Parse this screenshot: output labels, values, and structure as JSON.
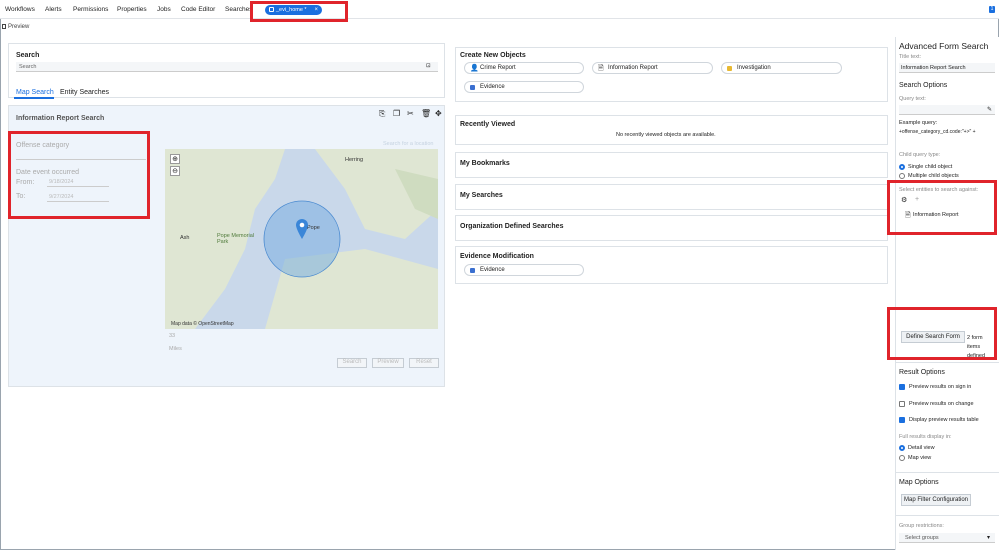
{
  "nav": {
    "items": [
      "Workflows",
      "Alerts",
      "Permissions",
      "Properties",
      "Jobs",
      "Code Editor",
      "Searches"
    ],
    "active_tab": "_evi_home *",
    "tab_close": "×",
    "badge": "1"
  },
  "preview_label": "Preview",
  "left": {
    "search_heading": "Search",
    "search_placeholder": "Search",
    "tabs": [
      "Map Search",
      "Entity Searches"
    ],
    "form_title": "Information Report Search",
    "offense_label": "Offense category",
    "date_label": "Date event occurred",
    "from_label": "From:",
    "to_label": "To:",
    "from_value": "9/18/2024",
    "to_value": "9/27/2024",
    "map_credit": "Map data © OpenStreetMap",
    "map_label_herring": "Herring",
    "map_label_ash": "Ash",
    "map_label_park": "Pope Memorial Park",
    "map_label_town": "Pope",
    "search_btn": "Search",
    "preview_btn": "Preview",
    "reset_btn": "Reset",
    "zoom_value": "33",
    "miles": "Miles",
    "selection_hint": "Search for a location"
  },
  "middle": {
    "create_title": "Create New Objects",
    "create_items": [
      "Crime Report",
      "Information Report",
      "Investigation",
      "Evidence"
    ],
    "recent_title": "Recently Viewed",
    "recent_empty": "No recently viewed objects are available.",
    "bookmarks_title": "My Bookmarks",
    "searches_title": "My Searches",
    "org_title": "Organization Defined Searches",
    "evmod_title": "Evidence Modification",
    "evmod_item": "Evidence"
  },
  "right": {
    "title": "Advanced Form Search",
    "title_text_label": "Title text:",
    "title_text_value": "Information Report Search",
    "search_options": "Search Options",
    "query_text_label": "Query text:",
    "example_label": "Example query:",
    "example_value": "+offense_category_cd.code:\"+>\" +",
    "child_query_label": "Child query type:",
    "single_child": "Single child object",
    "multiple_child": "Multiple child objects",
    "select_entities": "Select entities to search against:",
    "entity_item": "Information Report",
    "define_btn": "Define Search Form",
    "form_count": "2 form items defined",
    "result_options": "Result Options",
    "preview_signin": "Preview results on sign in",
    "preview_change": "Preview results on change",
    "display_table": "Display preview results table",
    "full_results": "Full results display in:",
    "detail_view": "Detail view",
    "map_view": "Map view",
    "map_options": "Map Options",
    "map_filter_btn": "Map Filter Configuration",
    "group_restrictions": "Group restrictions:",
    "select_groups": "Select groups"
  },
  "colors": {
    "accent": "#1a6fdf",
    "highlight": "#e0242b"
  }
}
